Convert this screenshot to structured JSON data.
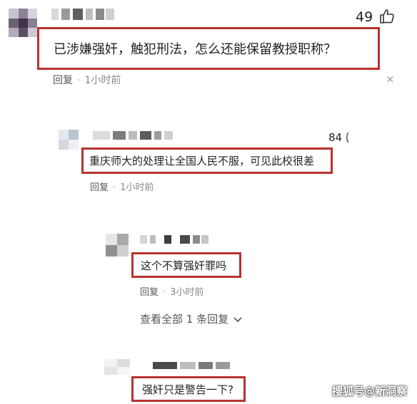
{
  "comments": [
    {
      "text": "已涉嫌强奸，触犯刑法，怎么还能保留教授职称？",
      "likes": "49",
      "reply_label": "回复",
      "time": "1小时前",
      "close_glyph": "×"
    },
    {
      "text": "重庆师大的处理让全国人民不服，可见此校很差",
      "likes": "84",
      "reply_label": "回复",
      "time": "1小时前"
    },
    {
      "text": "这个不算强奸罪吗",
      "reply_label": "回复",
      "time": "3小时前"
    },
    {
      "text": "强奸只是警告一下?"
    }
  ],
  "see_all_replies": "查看全部 1 条回复",
  "separator": "·",
  "watermark": "搜狐号@新洞察",
  "colors": {
    "highlight_border": "#b8312f",
    "meta_text": "#8a8a8a"
  },
  "icons": {
    "like": "thumb-up-icon",
    "chevron": "chevron-down-icon"
  }
}
